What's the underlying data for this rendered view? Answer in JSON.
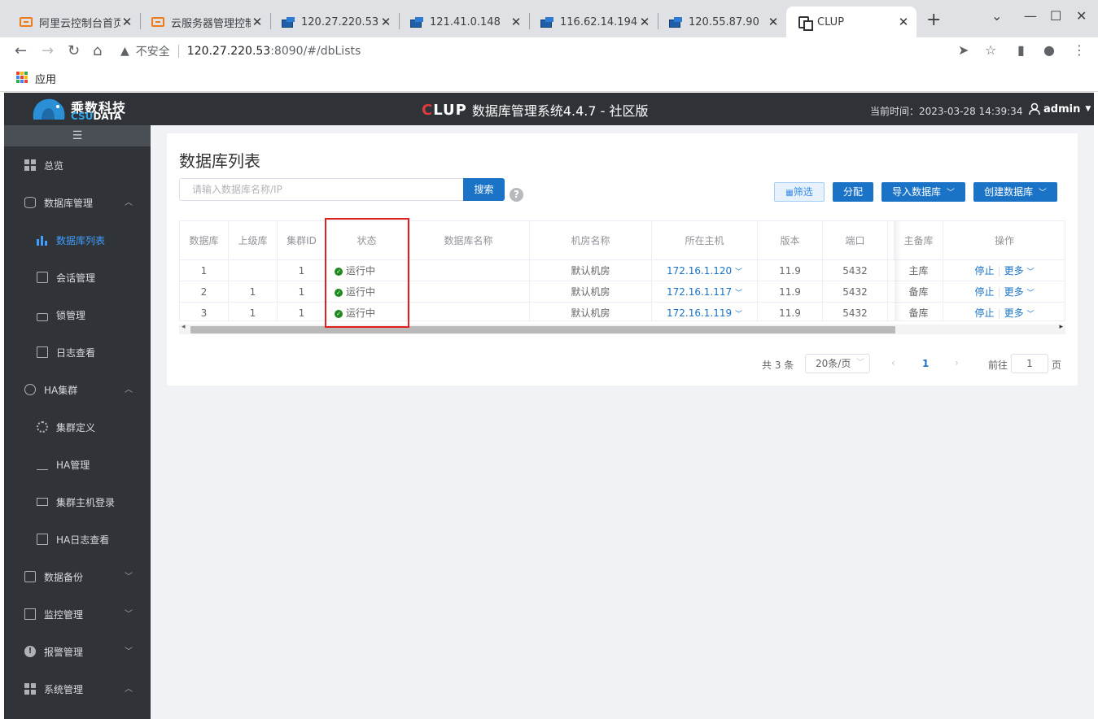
{
  "browser": {
    "tabs": [
      {
        "title": "阿里云控制台首页",
        "favicon": "aliyun-icon"
      },
      {
        "title": "云服务器管理控制台",
        "favicon": "aliyun-icon"
      },
      {
        "title": "120.27.220.53",
        "favicon": "remote-desktop-icon"
      },
      {
        "title": "121.41.0.148",
        "favicon": "remote-desktop-icon"
      },
      {
        "title": "116.62.14.194",
        "favicon": "remote-desktop-icon"
      },
      {
        "title": "120.55.87.90",
        "favicon": "remote-desktop-icon"
      },
      {
        "title": "CLUP",
        "favicon": "clup-icon",
        "active": true
      }
    ],
    "address": {
      "security_label": "不安全",
      "host": "120.27.220.53",
      "path": ":8090/#/dbLists"
    },
    "bookmarks": {
      "apps_label": "应用"
    }
  },
  "header": {
    "logo_line1": "乘数科技",
    "logo_line2_a": "CSU",
    "logo_line2_b": "DATA",
    "brand_c": "C",
    "brand_rest": "LUP",
    "title": "数据库管理系统4.4.7 - 社区版",
    "current_time": "当前时间：2023-03-28 14:39:34",
    "user": "admin"
  },
  "sidebar": {
    "toggle": "☰",
    "items": [
      {
        "label": "总览",
        "icon": "grid-icon"
      },
      {
        "label": "数据库管理",
        "icon": "database-icon",
        "arrow": "︿"
      },
      {
        "label": "数据库列表",
        "icon": "bar-chart-icon",
        "active": true
      },
      {
        "label": "会话管理",
        "icon": "chat-icon"
      },
      {
        "label": "锁管理",
        "icon": "lock-icon"
      },
      {
        "label": "日志查看",
        "icon": "document-icon"
      },
      {
        "label": "HA集群",
        "icon": "ha-icon",
        "arrow": "︿"
      },
      {
        "label": "集群定义",
        "icon": "gear-icon"
      },
      {
        "label": "HA管理",
        "icon": "tree-icon"
      },
      {
        "label": "集群主机登录",
        "icon": "monitor-icon"
      },
      {
        "label": "HA日志查看",
        "icon": "document-icon"
      },
      {
        "label": "数据备份",
        "icon": "backup-icon",
        "arrow": "﹀"
      },
      {
        "label": "监控管理",
        "icon": "dashboard-icon",
        "arrow": "﹀"
      },
      {
        "label": "报警管理",
        "icon": "alert-icon",
        "arrow": "﹀"
      },
      {
        "label": "系统管理",
        "icon": "grid-icon",
        "arrow": "︿"
      }
    ]
  },
  "main": {
    "title": "数据库列表",
    "search": {
      "placeholder": "请输入数据库名称/IP",
      "button": "搜索"
    },
    "help": "?",
    "buttons": {
      "filter": "筛选",
      "assign": "分配",
      "import": "导入数据库",
      "create": "创建数据库"
    },
    "table": {
      "headers": [
        "数据库",
        "上级库",
        "集群ID",
        "状态",
        "数据库名称",
        "机房名称",
        "所在主机",
        "版本",
        "端口",
        "主备库",
        "操作"
      ],
      "rows": [
        {
          "db": "1",
          "parent": "",
          "cluster": "1",
          "status": "运行中",
          "name": "",
          "room": "默认机房",
          "host": "172.16.1.120",
          "version": "11.9",
          "port": "5432",
          "role": "主库",
          "stop": "停止",
          "more": "更多"
        },
        {
          "db": "2",
          "parent": "1",
          "cluster": "1",
          "status": "运行中",
          "name": "",
          "room": "默认机房",
          "host": "172.16.1.117",
          "version": "11.9",
          "port": "5432",
          "role": "备库",
          "stop": "停止",
          "more": "更多"
        },
        {
          "db": "3",
          "parent": "1",
          "cluster": "1",
          "status": "运行中",
          "name": "",
          "room": "默认机房",
          "host": "172.16.1.119",
          "version": "11.9",
          "port": "5432",
          "role": "备库",
          "stop": "停止",
          "more": "更多"
        }
      ]
    },
    "pagination": {
      "total": "共 3 条",
      "page_size": "20条/页",
      "current": "1",
      "goto_label": "前往",
      "goto_value": "1",
      "page_suffix": "页"
    }
  }
}
